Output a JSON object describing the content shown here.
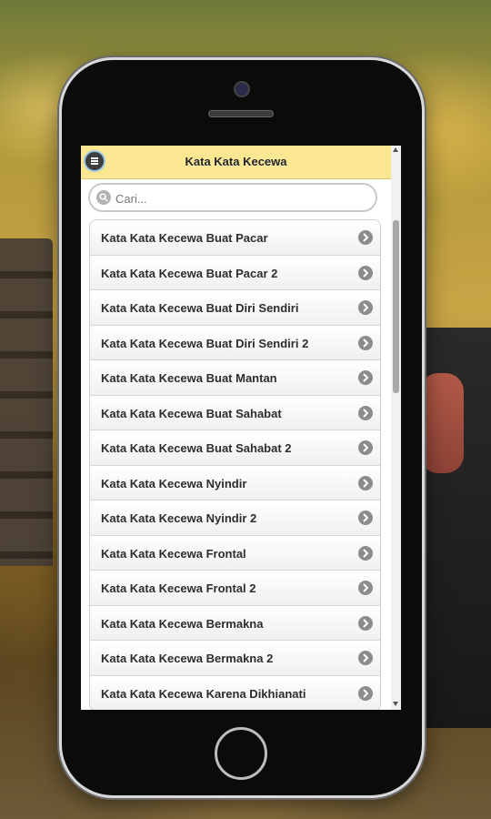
{
  "app": {
    "title": "Kata Kata Kecewa"
  },
  "header": {
    "menu_icon": "menu-icon"
  },
  "search": {
    "placeholder": "Cari...",
    "value": "",
    "icon": "search-icon"
  },
  "list": {
    "item_icon": "chevron-right-icon",
    "items": [
      {
        "label": "Kata Kata Kecewa Buat Pacar"
      },
      {
        "label": "Kata Kata Kecewa Buat Pacar 2"
      },
      {
        "label": "Kata Kata Kecewa Buat Diri Sendiri"
      },
      {
        "label": "Kata Kata Kecewa Buat Diri Sendiri 2"
      },
      {
        "label": "Kata Kata Kecewa Buat Mantan"
      },
      {
        "label": "Kata Kata Kecewa Buat Sahabat"
      },
      {
        "label": "Kata Kata Kecewa Buat Sahabat 2"
      },
      {
        "label": "Kata Kata Kecewa Nyindir"
      },
      {
        "label": "Kata Kata Kecewa Nyindir 2"
      },
      {
        "label": "Kata Kata Kecewa Frontal"
      },
      {
        "label": "Kata Kata Kecewa Frontal 2"
      },
      {
        "label": "Kata Kata Kecewa Bermakna"
      },
      {
        "label": "Kata Kata Kecewa Bermakna 2"
      },
      {
        "label": "Kata Kata Kecewa Karena Dikhianati"
      }
    ]
  },
  "colors": {
    "header_bg": "#fbe792",
    "list_text": "#2d2d2d",
    "chevron_bg": "#8c8c8c"
  }
}
